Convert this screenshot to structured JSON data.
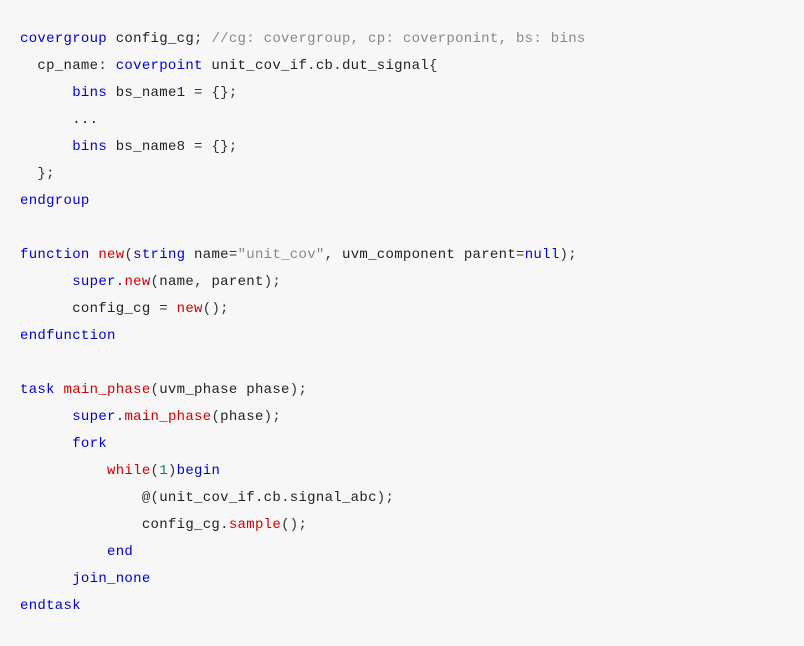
{
  "lines": [
    {
      "segments": [
        {
          "cls": "kw-blue",
          "t": "covergroup"
        },
        {
          "cls": "ident",
          "t": " config_cg"
        },
        {
          "cls": "punct",
          "t": "; "
        },
        {
          "cls": "comment",
          "t": "//cg: covergroup, cp: coverponint, bs: bins"
        }
      ]
    },
    {
      "segments": [
        {
          "cls": "ident",
          "t": "  cp_name"
        },
        {
          "cls": "punct",
          "t": ": "
        },
        {
          "cls": "kw-blue",
          "t": "coverpoint"
        },
        {
          "cls": "ident",
          "t": " unit_cov_if"
        },
        {
          "cls": "punct",
          "t": "."
        },
        {
          "cls": "ident",
          "t": "cb"
        },
        {
          "cls": "punct",
          "t": "."
        },
        {
          "cls": "ident",
          "t": "dut_signal"
        },
        {
          "cls": "punct",
          "t": "{"
        }
      ]
    },
    {
      "segments": [
        {
          "cls": "ident",
          "t": "      "
        },
        {
          "cls": "kw-blue",
          "t": "bins"
        },
        {
          "cls": "ident",
          "t": " bs_name1 "
        },
        {
          "cls": "punct",
          "t": "= {};"
        }
      ]
    },
    {
      "segments": [
        {
          "cls": "ident",
          "t": "      ..."
        }
      ]
    },
    {
      "segments": [
        {
          "cls": "ident",
          "t": "      "
        },
        {
          "cls": "kw-blue",
          "t": "bins"
        },
        {
          "cls": "ident",
          "t": " bs_name8 "
        },
        {
          "cls": "punct",
          "t": "= {};"
        }
      ]
    },
    {
      "segments": [
        {
          "cls": "punct",
          "t": "  };"
        }
      ]
    },
    {
      "segments": [
        {
          "cls": "kw-blue",
          "t": "endgroup"
        }
      ]
    },
    {
      "empty": true
    },
    {
      "segments": [
        {
          "cls": "kw-blue",
          "t": "function"
        },
        {
          "cls": "ident",
          "t": " "
        },
        {
          "cls": "kw-red",
          "t": "new"
        },
        {
          "cls": "punct",
          "t": "("
        },
        {
          "cls": "kw-blue",
          "t": "string"
        },
        {
          "cls": "ident",
          "t": " name"
        },
        {
          "cls": "punct",
          "t": "="
        },
        {
          "cls": "str",
          "t": "\"unit_cov\""
        },
        {
          "cls": "punct",
          "t": ", "
        },
        {
          "cls": "ident",
          "t": "uvm_component parent"
        },
        {
          "cls": "punct",
          "t": "="
        },
        {
          "cls": "kw-blue",
          "t": "null"
        },
        {
          "cls": "punct",
          "t": ");"
        }
      ]
    },
    {
      "segments": [
        {
          "cls": "ident",
          "t": "      "
        },
        {
          "cls": "kw-blue",
          "t": "super"
        },
        {
          "cls": "punct",
          "t": "."
        },
        {
          "cls": "kw-red",
          "t": "new"
        },
        {
          "cls": "punct",
          "t": "("
        },
        {
          "cls": "ident",
          "t": "name"
        },
        {
          "cls": "punct",
          "t": ", "
        },
        {
          "cls": "ident",
          "t": "parent"
        },
        {
          "cls": "punct",
          "t": ");"
        }
      ]
    },
    {
      "segments": [
        {
          "cls": "ident",
          "t": "      config_cg "
        },
        {
          "cls": "punct",
          "t": "= "
        },
        {
          "cls": "kw-red",
          "t": "new"
        },
        {
          "cls": "punct",
          "t": "();"
        }
      ]
    },
    {
      "segments": [
        {
          "cls": "kw-blue",
          "t": "endfunction"
        }
      ]
    },
    {
      "empty": true
    },
    {
      "segments": [
        {
          "cls": "kw-blue",
          "t": "task"
        },
        {
          "cls": "ident",
          "t": " "
        },
        {
          "cls": "kw-red",
          "t": "main_phase"
        },
        {
          "cls": "punct",
          "t": "("
        },
        {
          "cls": "ident",
          "t": "uvm_phase phase"
        },
        {
          "cls": "punct",
          "t": ");"
        }
      ]
    },
    {
      "segments": [
        {
          "cls": "ident",
          "t": "      "
        },
        {
          "cls": "kw-blue",
          "t": "super"
        },
        {
          "cls": "punct",
          "t": "."
        },
        {
          "cls": "kw-red",
          "t": "main_phase"
        },
        {
          "cls": "punct",
          "t": "("
        },
        {
          "cls": "ident",
          "t": "phase"
        },
        {
          "cls": "punct",
          "t": ");"
        }
      ]
    },
    {
      "segments": [
        {
          "cls": "ident",
          "t": "      "
        },
        {
          "cls": "kw-blue",
          "t": "fork"
        }
      ]
    },
    {
      "segments": [
        {
          "cls": "ident",
          "t": "          "
        },
        {
          "cls": "kw-red",
          "t": "while"
        },
        {
          "cls": "punct",
          "t": "("
        },
        {
          "cls": "num",
          "t": "1"
        },
        {
          "cls": "punct",
          "t": ")"
        },
        {
          "cls": "kw-blue",
          "t": "begin"
        }
      ]
    },
    {
      "segments": [
        {
          "cls": "ident",
          "t": "              "
        },
        {
          "cls": "punct",
          "t": "@("
        },
        {
          "cls": "ident",
          "t": "unit_cov_if"
        },
        {
          "cls": "punct",
          "t": "."
        },
        {
          "cls": "ident",
          "t": "cb"
        },
        {
          "cls": "punct",
          "t": "."
        },
        {
          "cls": "ident",
          "t": "signal_abc"
        },
        {
          "cls": "punct",
          "t": ");"
        }
      ]
    },
    {
      "segments": [
        {
          "cls": "ident",
          "t": "              config_cg"
        },
        {
          "cls": "punct",
          "t": "."
        },
        {
          "cls": "kw-red",
          "t": "sample"
        },
        {
          "cls": "punct",
          "t": "();"
        }
      ]
    },
    {
      "segments": [
        {
          "cls": "ident",
          "t": "          "
        },
        {
          "cls": "kw-blue",
          "t": "end"
        }
      ]
    },
    {
      "segments": [
        {
          "cls": "ident",
          "t": "      "
        },
        {
          "cls": "kw-blue",
          "t": "join_none"
        }
      ]
    },
    {
      "segments": [
        {
          "cls": "kw-blue",
          "t": "endtask"
        }
      ]
    }
  ]
}
